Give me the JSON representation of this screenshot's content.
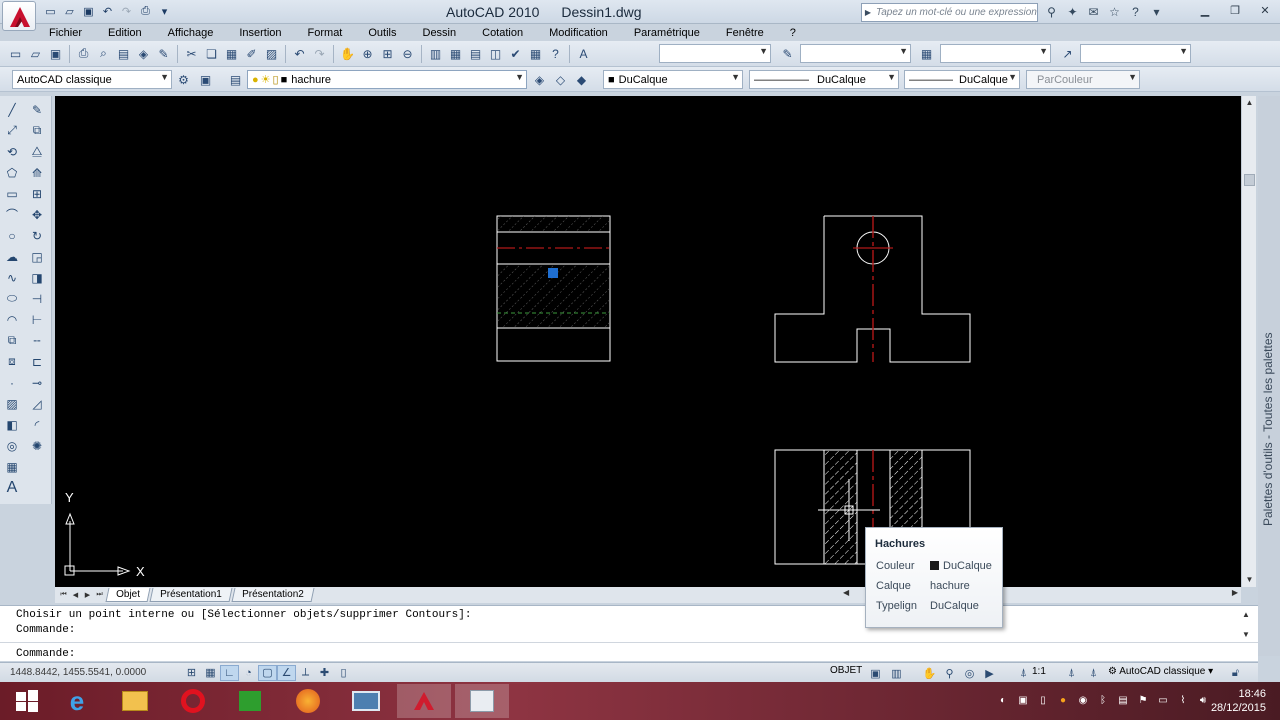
{
  "window": {
    "app_title": "AutoCAD 2010",
    "file_title": "Dessin1.dwg",
    "search_placeholder": "Tapez un mot-clé ou une expression"
  },
  "menu": [
    "Fichier",
    "Edition",
    "Affichage",
    "Insertion",
    "Format",
    "Outils",
    "Dessin",
    "Cotation",
    "Modification",
    "Paramétrique",
    "Fenêtre",
    "?"
  ],
  "toolbars": {
    "workspace": "AutoCAD classique",
    "layer": "hachure",
    "color": "DuCalque",
    "linetype": "DuCalque",
    "lineweight": "DuCalque",
    "plotstyle": "ParCouleur"
  },
  "ucs": {
    "x_label": "X",
    "y_label": "Y"
  },
  "tabs": [
    "Objet",
    "Présentation1",
    "Présentation2"
  ],
  "tooltip": {
    "title": "Hachures",
    "rows": [
      {
        "key": "Couleur",
        "value": "DuCalque"
      },
      {
        "key": "Calque",
        "value": "hachure"
      },
      {
        "key": "Typelign",
        "value": "DuCalque"
      }
    ]
  },
  "command": {
    "line1": "Choisir un point interne ou [Sélectionner objets/supprimer Contours]:",
    "line2": "Commande:",
    "line3": "Commande:"
  },
  "status": {
    "coords": "1448.8442, 1455.5541, 0.0000",
    "model": "OBJET",
    "scale": "1:1",
    "workspace": "AutoCAD classique"
  },
  "palette_label": "Palettes d'outils - Toutes les palettes",
  "clock": {
    "time": "18:46",
    "date": "28/12/2015"
  },
  "colors": {
    "canvas": "#000000",
    "centerline": "#b01818",
    "accent": "#1f6fd1"
  }
}
